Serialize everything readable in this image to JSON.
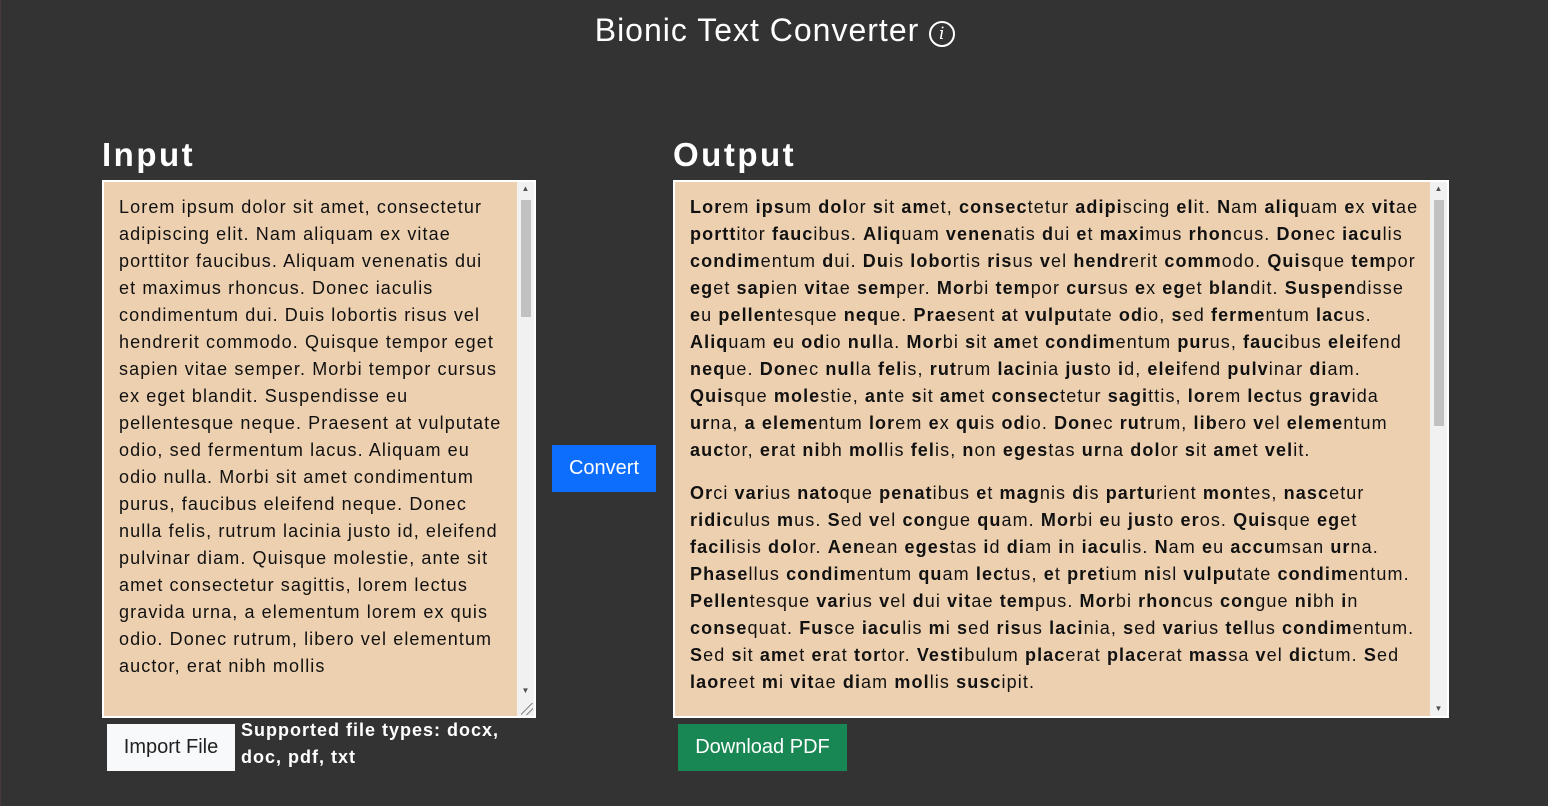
{
  "header": {
    "title": "Bionic Text Converter",
    "info_icon": "info-icon"
  },
  "input": {
    "label": "Input",
    "text": "Lorem ipsum dolor sit amet, consectetur adipiscing elit. Nam aliquam ex vitae porttitor faucibus. Aliquam venenatis dui et maximus rhoncus. Donec iaculis condimentum dui. Duis lobortis risus vel hendrerit commodo. Quisque tempor eget sapien vitae semper. Morbi tempor cursus ex eget blandit. Suspendisse eu pellentesque neque. Praesent at vulputate odio, sed fermentum lacus. Aliquam eu odio nulla. Morbi sit amet condimentum purus, faucibus eleifend neque. Donec nulla felis, rutrum lacinia justo id, eleifend pulvinar diam. Quisque molestie, ante sit amet consectetur sagittis, lorem lectus gravida urna, a elementum lorem ex quis odio. Donec rutrum, libero vel elementum auctor, erat nibh mollis"
  },
  "output": {
    "label": "Output",
    "paragraphs": [
      "Lorem ipsum dolor sit amet, consectetur adipiscing elit. Nam aliquam ex vitae porttitor faucibus. Aliquam venenatis dui et maximus rhoncus. Donec iaculis condimentum dui. Duis lobortis risus vel hendrerit commodo. Quisque tempor eget sapien vitae semper. Morbi tempor cursus ex eget blandit. Suspendisse eu pellentesque neque. Praesent at vulputate odio, sed fermentum lacus. Aliquam eu odio nulla. Morbi sit amet condimentum purus, faucibus eleifend neque. Donec nulla felis, rutrum lacinia justo id, eleifend pulvinar diam. Quisque molestie, ante sit amet consectetur sagittis, lorem lectus gravida urna, a elementum lorem ex quis odio. Donec rutrum, libero vel elementum auctor, erat nibh mollis felis, non egestas urna dolor sit amet velit.",
      "Orci varius natoque penatibus et magnis dis parturient montes, nascetur ridiculus mus. Sed vel congue quam. Morbi eu justo eros. Quisque eget facilisis dolor. Aenean egestas id diam in iaculis. Nam eu accumsan urna. Phasellus condimentum quam lectus, et pretium nisl vulputate condimentum. Pellentesque varius vel dui vitae tempus. Morbi rhoncus congue nibh in consequat. Fusce iaculis mi sed risus lacinia, sed varius tellus condimentum. Sed sit amet erat tortor. Vestibulum placerat placerat massa vel dictum. Sed laoreet mi vitae diam mollis suscipit."
    ]
  },
  "buttons": {
    "convert": "Convert",
    "import": "Import File",
    "download": "Download PDF"
  },
  "file_types_note": "Supported file types: docx, doc, pdf, txt",
  "colors": {
    "background": "#333333",
    "text_box": "#edd0b0",
    "convert": "#0d6efd",
    "download": "#198754",
    "import": "#f8f9fa"
  }
}
